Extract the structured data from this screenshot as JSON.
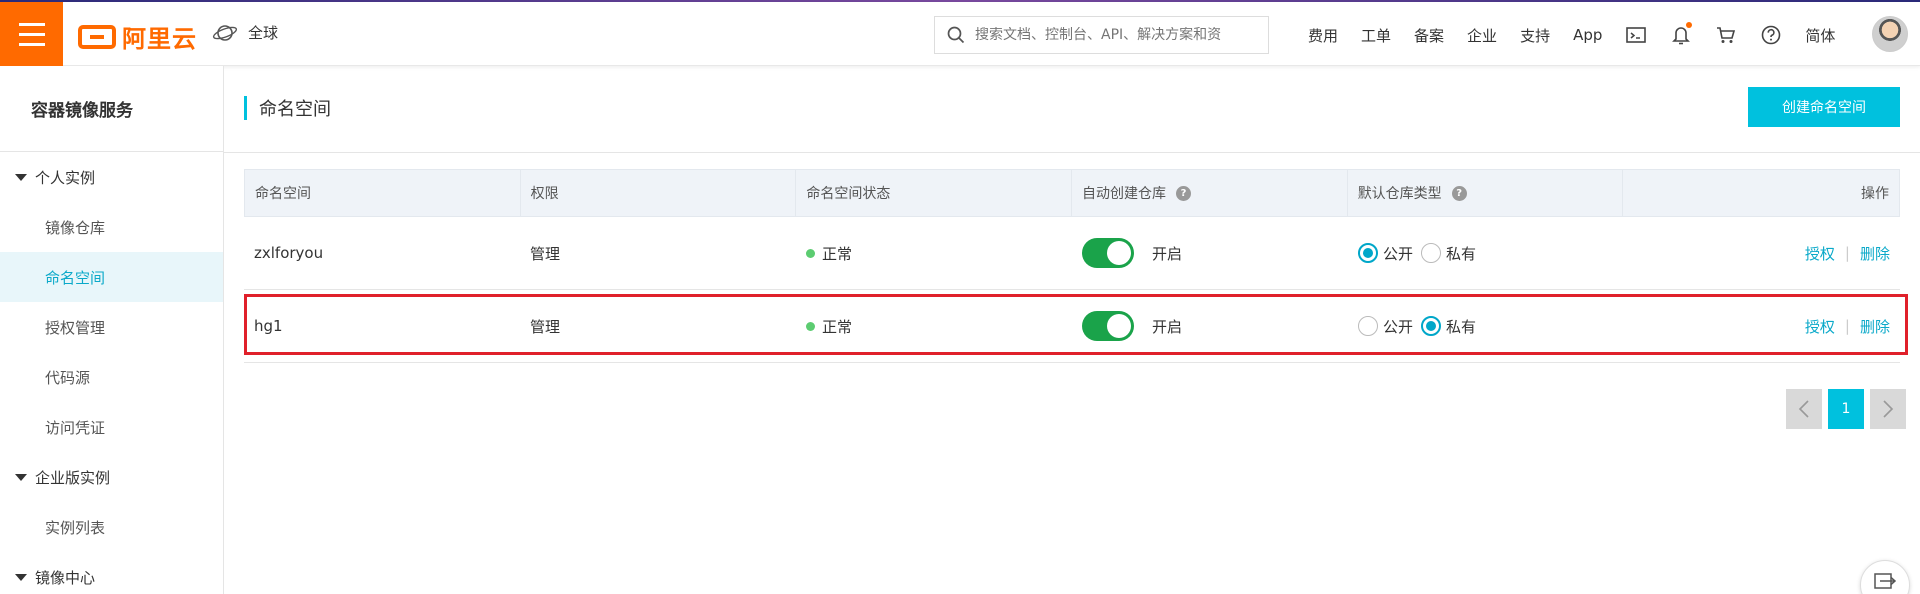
{
  "topbar": {
    "brand": "阿里云",
    "region": "全球",
    "search_placeholder": "搜索文档、控制台、API、解决方案和资",
    "nav": [
      "费用",
      "工单",
      "备案",
      "企业",
      "支持",
      "App"
    ],
    "lang": "简体",
    "accent_color": "#ff6a00"
  },
  "sidebar": {
    "title": "容器镜像服务",
    "group1": "个人实例",
    "items1": [
      "镜像仓库",
      "命名空间",
      "授权管理",
      "代码源",
      "访问凭证"
    ],
    "group2": "企业版实例",
    "items2": [
      "实例列表"
    ],
    "group3": "镜像中心"
  },
  "main": {
    "title": "命名空间",
    "create_button": "创建命名空间",
    "columns": [
      "命名空间",
      "权限",
      "命名空间状态",
      "自动创建仓库",
      "默认仓库类型",
      "操作"
    ],
    "rows": [
      {
        "name": "zxlforyou",
        "perm": "管理",
        "status": "正常",
        "auto": "开启",
        "public": "公开",
        "private": "私有",
        "selected": "公开",
        "action_auth": "授权",
        "action_delete": "删除",
        "sep": "|"
      },
      {
        "name": "hg1",
        "perm": "管理",
        "status": "正常",
        "auto": "开启",
        "public": "公开",
        "private": "私有",
        "selected": "私有",
        "action_auth": "授权",
        "action_delete": "删除",
        "sep": "|"
      }
    ],
    "pager": {
      "current": "1"
    },
    "help_glyph": "?"
  }
}
